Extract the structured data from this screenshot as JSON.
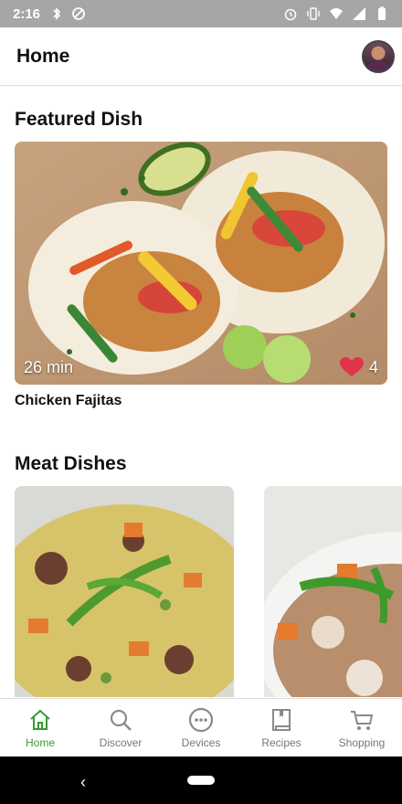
{
  "status_bar": {
    "time": "2:16",
    "icons": [
      "bluetooth-icon",
      "data-saver-icon",
      "alarm-icon",
      "vibrate-icon",
      "wifi-icon",
      "signal-icon",
      "battery-icon"
    ]
  },
  "app_bar": {
    "title": "Home"
  },
  "featured": {
    "section_title": "Featured Dish",
    "dish_name": "Chicken Fajitas",
    "time": "26 min",
    "likes": "4"
  },
  "meat": {
    "section_title": "Meat Dishes"
  },
  "bottom_nav": {
    "items": [
      {
        "label": "Home",
        "icon": "home-icon",
        "active": true
      },
      {
        "label": "Discover",
        "icon": "search-icon",
        "active": false
      },
      {
        "label": "Devices",
        "icon": "devices-icon",
        "active": false
      },
      {
        "label": "Recipes",
        "icon": "book-icon",
        "active": false
      },
      {
        "label": "Shopping",
        "icon": "cart-icon",
        "active": false
      }
    ]
  },
  "colors": {
    "accent": "#3a9b35",
    "status_bar": "#a6a6a6",
    "heart": "#e0344a"
  }
}
